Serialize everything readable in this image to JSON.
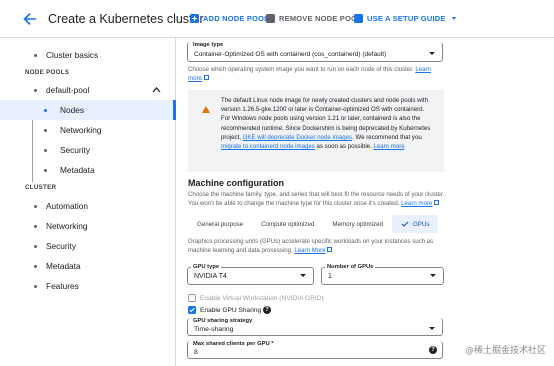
{
  "header": {
    "title": "Create a Kubernetes cluster",
    "actions": [
      {
        "label": "ADD NODE POOL",
        "color": "#1a73e8"
      },
      {
        "label": "REMOVE NODE POOL",
        "color": "#5f6368"
      },
      {
        "label": "USE A SETUP GUIDE",
        "color": "#1a73e8"
      }
    ]
  },
  "sidebar": {
    "cluster_basics": "Cluster basics",
    "node_pools_heading": "NODE POOLS",
    "default_pool": "default-pool",
    "pool_items": [
      "Nodes",
      "Networking",
      "Security",
      "Metadata"
    ],
    "cluster_heading": "CLUSTER",
    "cluster_items": [
      "Automation",
      "Networking",
      "Security",
      "Metadata",
      "Features"
    ]
  },
  "main": {
    "image_type": {
      "label": "Image type",
      "value": "Container-Optimized OS with containerd (cos_containerd) (default)",
      "help": "Choose which operating system image you want to run on each node of this cluster.",
      "help_link": "Learn more"
    },
    "warning": {
      "text_1": "The default Linux node image for newly created clusters and node pools with version 1.26.5-gke.1200 or later is Container-optimized OS with containerd. For Windows node pools using version 1.21 or later, containerd is also the recommended runtime. Since Dockershim is being deprecated by Kubernetes project,",
      "link_1": "GKE will deprecate Docker node images",
      "text_2": ". We recommend that you",
      "link_2": "migrate to containerd node images",
      "text_3": "as soon as possible.",
      "link_3": "Learn more"
    },
    "machine_config": {
      "heading": "Machine configuration",
      "help": "Choose the machine family, type, and series that will best fit the resource needs of your cluster. You won't be able to change the machine type for this cluster once it's created.",
      "help_link": "Learn more",
      "tabs": [
        "General purpose",
        "Compute optimized",
        "Memory optimized",
        "GPUs"
      ],
      "selected_tab": "GPUs",
      "gpu_help": "Graphics processing units (GPUs) accelerate specific workloads on your instances such as machine learning and data processing.",
      "gpu_help_link": "Learn More"
    },
    "gpu_type": {
      "label": "GPU type",
      "value": "NVIDIA T4"
    },
    "gpu_count": {
      "label": "Number of GPUs",
      "value": "1"
    },
    "virtual_workstation": {
      "label": "Enable Virtual Workstation (NVIDIA GRID)",
      "checked": false
    },
    "gpu_sharing": {
      "label": "Enable GPU Sharing",
      "checked": true
    },
    "sharing_strategy": {
      "label": "GPU sharing strategy",
      "value": "Time-sharing"
    },
    "max_clients": {
      "label": "Max shared clients per GPU *",
      "value": "8"
    }
  },
  "watermark": "@稀土掘金技术社区"
}
